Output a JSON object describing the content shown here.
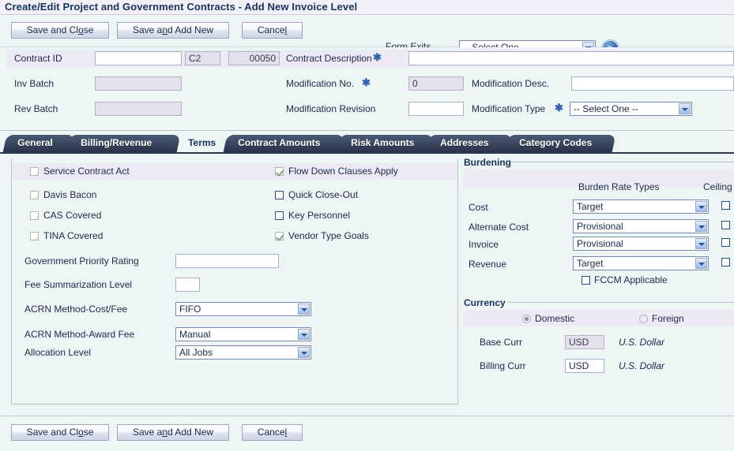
{
  "window": {
    "title": "Create/Edit Project and Government Contracts - Add New Invoice Level"
  },
  "toolbar": {
    "save_close_label": "Save and Close",
    "save_close_accel": "o",
    "save_add_label": "Save and Add New",
    "save_add_accel": "n",
    "cancel_label": "Cancel",
    "cancel_accel": "l",
    "form_exits_label": "Form Exits",
    "form_exits_value": "-- Select One --",
    "go_icon": "»"
  },
  "header": {
    "contract_id_label": "Contract ID",
    "contract_id_value": "",
    "contract_type_value": "C2",
    "contract_number_value": "00050",
    "contract_desc_label": "Contract Description",
    "contract_desc_required": "✱",
    "contract_desc_value": "",
    "inv_batch_label": "Inv Batch",
    "inv_batch_value": "",
    "rev_batch_label": "Rev Batch",
    "rev_batch_value": "",
    "modification_no_label": "Modification No.",
    "modification_no_required": "✱",
    "modification_no_value": "0",
    "modification_desc_label": "Modification Desc.",
    "modification_desc_value": "",
    "modification_revision_label": "Modification Revision",
    "modification_revision_value": "",
    "modification_type_label": "Modification Type",
    "modification_type_required": "✱",
    "modification_type_value": "-- Select One --"
  },
  "tabs": [
    {
      "label": "General",
      "active": false
    },
    {
      "label": "Billing/Revenue",
      "active": false
    },
    {
      "label": "Terms",
      "active": true
    },
    {
      "label": "Contract Amounts",
      "active": false
    },
    {
      "label": "Risk Amounts",
      "active": false
    },
    {
      "label": "Addresses",
      "active": false
    },
    {
      "label": "Category Codes",
      "active": false
    }
  ],
  "terms": {
    "checkboxes_left": [
      {
        "label": "Service Contract Act",
        "checked": false,
        "enabled": false
      },
      {
        "label": "Davis Bacon",
        "checked": false,
        "enabled": false
      },
      {
        "label": "CAS Covered",
        "checked": false,
        "enabled": false
      },
      {
        "label": "TINA Covered",
        "checked": false,
        "enabled": false
      }
    ],
    "checkboxes_mid": [
      {
        "label": "Flow Down Clauses Apply",
        "checked": true,
        "enabled": false
      },
      {
        "label": "Quick Close-Out",
        "checked": false,
        "enabled": true
      },
      {
        "label": "Key Personnel",
        "checked": false,
        "enabled": true
      },
      {
        "label": "Vendor Type Goals",
        "checked": true,
        "enabled": false
      }
    ],
    "gov_priority_rating_label": "Government Priority Rating",
    "gov_priority_rating_value": "",
    "fee_summarization_label": "Fee Summarization Level",
    "fee_summarization_value": "",
    "acrn_cost_fee_label": "ACRN Method-Cost/Fee",
    "acrn_cost_fee_value": "FIFO",
    "acrn_award_fee_label": "ACRN Method-Award Fee",
    "acrn_award_fee_value": "Manual",
    "allocation_level_label": "Allocation Level",
    "allocation_level_value": "All Jobs"
  },
  "burdening": {
    "title": "Burdening",
    "col_rate_types": "Burden Rate Types",
    "col_ceiling": "Ceiling",
    "rows": [
      {
        "label": "Cost",
        "rate_type": "Target",
        "ceiling": false
      },
      {
        "label": "Alternate Cost",
        "rate_type": "Provisional",
        "ceiling": false
      },
      {
        "label": "Invoice",
        "rate_type": "Provisional",
        "ceiling": false
      },
      {
        "label": "Revenue",
        "rate_type": "Target",
        "ceiling": false
      }
    ],
    "fccm_label": "FCCM Applicable",
    "fccm_checked": false
  },
  "currency": {
    "title": "Currency",
    "domestic_label": "Domestic",
    "domestic_selected": true,
    "foreign_label": "Foreign",
    "foreign_selected": false,
    "base_curr_label": "Base Curr",
    "base_curr_value": "USD",
    "base_curr_desc": "U.S. Dollar",
    "billing_curr_label": "Billing Curr",
    "billing_curr_value": "USD",
    "billing_curr_desc": "U.S. Dollar"
  },
  "footer": {
    "save_close_label": "Save and Close",
    "save_close_accel": "o",
    "save_add_label": "Save and Add New",
    "save_add_accel": "n",
    "cancel_label": "Cancel",
    "cancel_accel": "l"
  },
  "colors": {
    "title_text": "#17325c",
    "panel_bg": "#eef5f5",
    "stripe": "#edeaf5",
    "tab_dark": "#2c3850",
    "required": "#2d63ae"
  }
}
